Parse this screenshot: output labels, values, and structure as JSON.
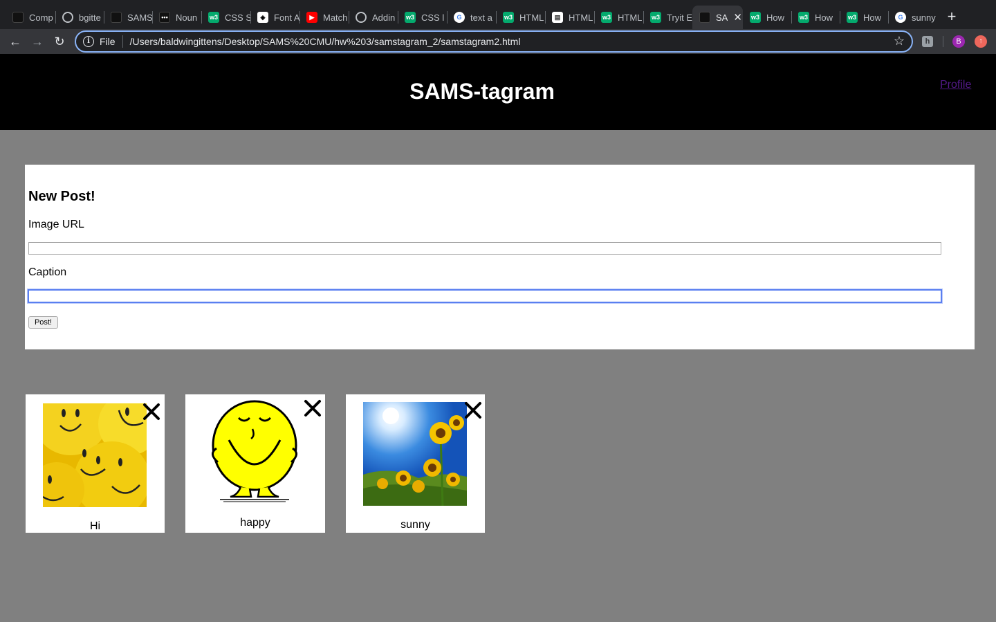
{
  "browser": {
    "tabs": [
      {
        "label": "Comp",
        "favicon": "dark"
      },
      {
        "label": "bgitte",
        "favicon": "gh"
      },
      {
        "label": "SAMS",
        "favicon": "dark"
      },
      {
        "label": "Noun",
        "favicon": "dark"
      },
      {
        "label": "CSS S",
        "favicon": "w3"
      },
      {
        "label": "Font A",
        "favicon": "fa"
      },
      {
        "label": "Match",
        "favicon": "yt"
      },
      {
        "label": "Addin",
        "favicon": "gh"
      },
      {
        "label": "CSS l",
        "favicon": "w3"
      },
      {
        "label": "text a",
        "favicon": "g"
      },
      {
        "label": "HTML",
        "favicon": "w3"
      },
      {
        "label": "HTML",
        "favicon": "doc"
      },
      {
        "label": "HTML",
        "favicon": "w3"
      },
      {
        "label": "Tryit E",
        "favicon": "w3"
      },
      {
        "label": "SA",
        "favicon": "dark",
        "active": true
      },
      {
        "label": "How",
        "favicon": "w3"
      },
      {
        "label": "How",
        "favicon": "w3"
      },
      {
        "label": "How",
        "favicon": "w3"
      },
      {
        "label": "sunny",
        "favicon": "g"
      }
    ],
    "address": {
      "scheme": "File",
      "url": "/Users/baldwingittens/Desktop/SAMS%20CMU/hw%203/samstagram_2/samstagram2.html"
    },
    "profile_initial": "B"
  },
  "page": {
    "title": "SAMS-tagram",
    "profile_link": "Profile",
    "form": {
      "heading": "New Post!",
      "image_url_label": "Image URL",
      "image_url_value": "",
      "caption_label": "Caption",
      "caption_value": "",
      "submit_label": "Post!"
    },
    "posts": [
      {
        "caption": "Hi",
        "image": "yellow-smiley-balls"
      },
      {
        "caption": "happy",
        "image": "mr-happy-cartoon"
      },
      {
        "caption": "sunny",
        "image": "sunflowers-under-sun"
      }
    ]
  },
  "colors": {
    "page_background": "#808080",
    "header_background": "#000000",
    "link_visited": "#551a8b",
    "focus_ring": "#5a7ff0"
  }
}
